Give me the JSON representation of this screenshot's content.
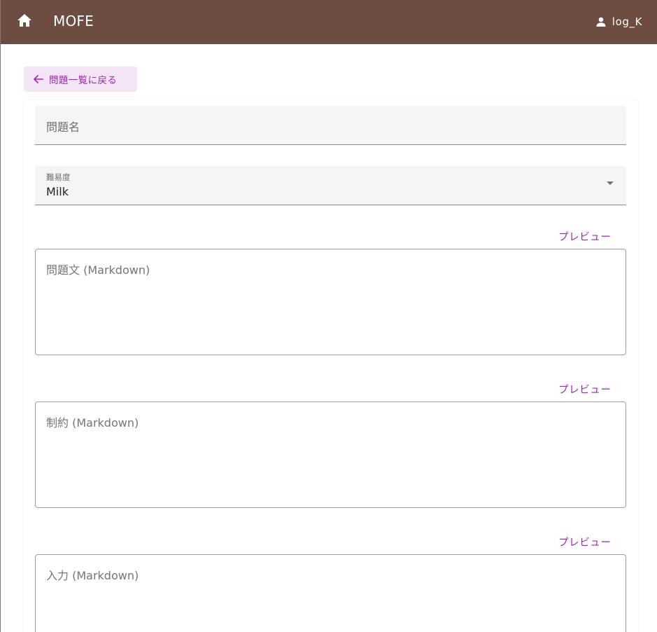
{
  "appbar": {
    "title": "MOFE",
    "home_icon": "home-icon",
    "user": {
      "icon": "person-icon",
      "name": "log_K"
    },
    "background_color": "#6d4c41"
  },
  "back_button": {
    "label": "問題一覧に戻る",
    "icon": "arrow-left-icon"
  },
  "form": {
    "problem_name": {
      "placeholder": "問題名",
      "value": ""
    },
    "difficulty": {
      "label": "難易度",
      "value": "Milk"
    },
    "statement": {
      "preview_label": "プレビュー",
      "placeholder": "問題文 (Markdown)",
      "value": ""
    },
    "constraints": {
      "preview_label": "プレビュー",
      "placeholder": "制約 (Markdown)",
      "value": ""
    },
    "input": {
      "preview_label": "プレビュー",
      "placeholder": "入力 (Markdown)",
      "value": ""
    }
  },
  "colors": {
    "accent": "#9c27b0",
    "accent_background": "#f3e5f5"
  }
}
